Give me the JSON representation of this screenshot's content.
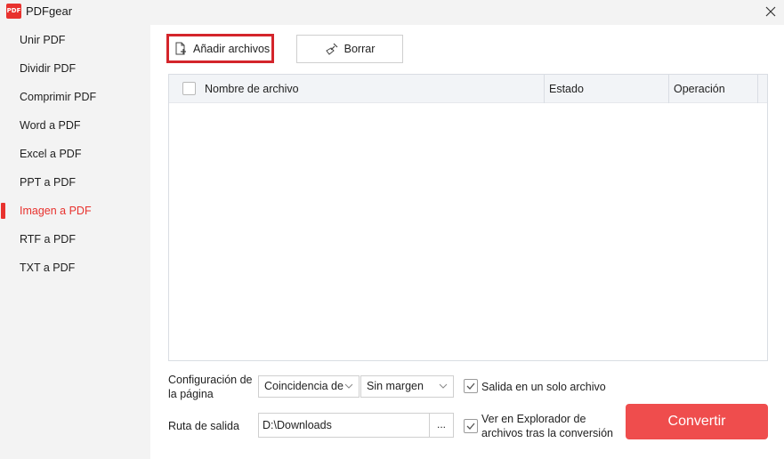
{
  "window": {
    "title": "PDFgear",
    "logo_text": "PDF"
  },
  "sidebar": {
    "items": [
      {
        "label": "Unir PDF"
      },
      {
        "label": "Dividir PDF"
      },
      {
        "label": "Comprimir PDF"
      },
      {
        "label": "Word a PDF"
      },
      {
        "label": "Excel a PDF"
      },
      {
        "label": "PPT a PDF"
      },
      {
        "label": "Imagen a PDF",
        "active": true
      },
      {
        "label": "RTF a PDF"
      },
      {
        "label": "TXT a PDF"
      }
    ]
  },
  "toolbar": {
    "add_label": "Añadir archivos",
    "clear_label": "Borrar"
  },
  "table": {
    "columns": [
      "Nombre de archivo",
      "Estado",
      "Operación"
    ],
    "rows": []
  },
  "settings": {
    "page_config_label": "Configuración de la página",
    "page_config_line1": "Configuración de",
    "page_config_line2": "la página",
    "fit_value": "Coincidencia de",
    "margin_value": "Sin margen",
    "single_file_label": "Salida en un solo archivo",
    "output_path_label": "Ruta de salida",
    "output_path_value": "D:\\Downloads",
    "browse_label": "...",
    "explorer_line1": "Ver en Explorador de",
    "explorer_line2": "archivos tras la conversión"
  },
  "actions": {
    "convert_label": "Convertir"
  },
  "colors": {
    "accent": "#e8322e",
    "convert_bg": "#ef4d4d",
    "highlight_border": "#d4252b"
  },
  "icons": {
    "logo": "pdfgear-logo",
    "close": "close-icon",
    "add_file": "file-add-icon",
    "clear": "broom-icon",
    "chevron": "chevron-down-icon",
    "check": "check-icon"
  }
}
